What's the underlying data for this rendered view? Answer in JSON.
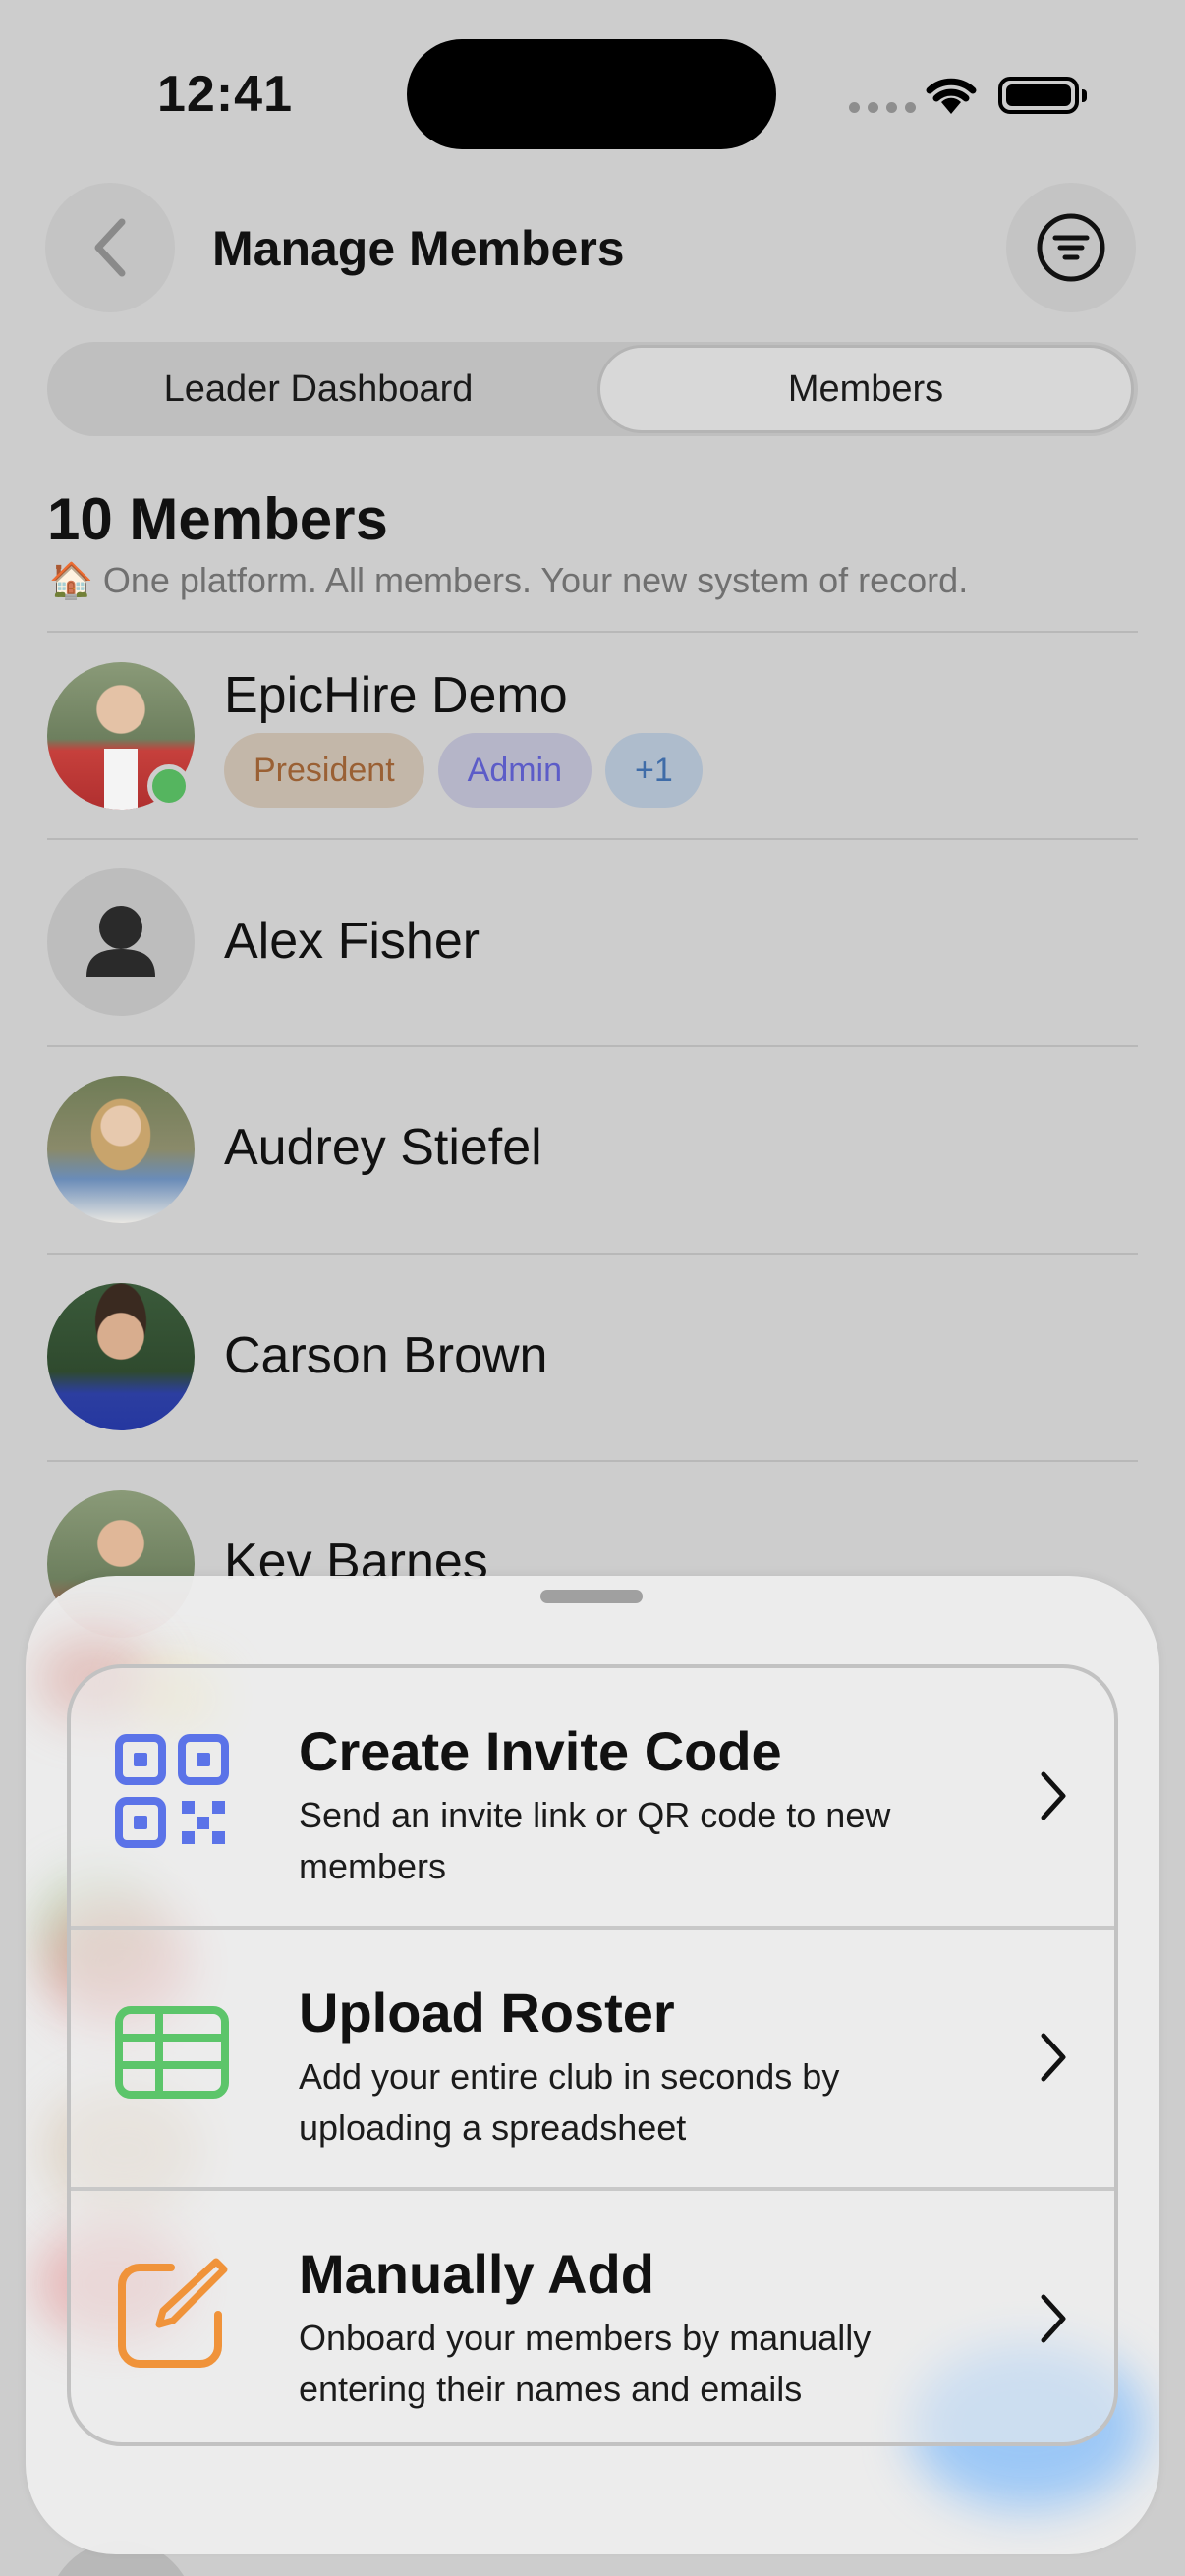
{
  "status_bar": {
    "time": "12:41"
  },
  "header": {
    "title": "Manage Members"
  },
  "tabs": [
    {
      "label": "Leader Dashboard",
      "selected": false
    },
    {
      "label": "Members",
      "selected": true
    }
  ],
  "members_section": {
    "count_label": "10 Members",
    "subtitle_emoji": "🏠",
    "subtitle": "One platform. All members. Your new system of record."
  },
  "members": [
    {
      "name": "EpicHire Demo",
      "online": true,
      "badges": [
        "President",
        "Admin",
        "+1"
      ]
    },
    {
      "name": "Alex Fisher",
      "placeholder_avatar": true
    },
    {
      "name": "Audrey Stiefel"
    },
    {
      "name": "Carson Brown"
    },
    {
      "name": "Kev Barnes"
    }
  ],
  "sheet": {
    "options": [
      {
        "title": "Create Invite Code",
        "description": "Send an invite link or QR code to new members",
        "icon": "qr-code-icon",
        "color": "#5b73e8"
      },
      {
        "title": "Upload Roster",
        "description": "Add your entire club in seconds by uploading a spreadsheet",
        "icon": "spreadsheet-icon",
        "color": "#5cc56a"
      },
      {
        "title": "Manually Add",
        "description": "Onboard your members by manually entering their names and emails",
        "icon": "edit-icon",
        "color": "#f0933a"
      }
    ]
  }
}
